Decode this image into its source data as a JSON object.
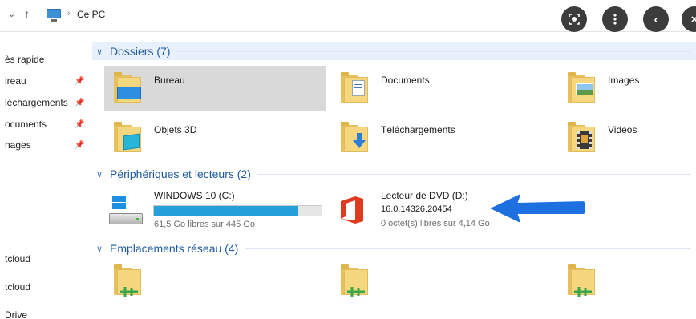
{
  "address": {
    "location": "Ce PC",
    "separator": "›"
  },
  "top_buttons": [
    "lens-icon",
    "more-icon",
    "back-icon",
    "close-icon"
  ],
  "sidebar": {
    "items": [
      {
        "label": "ès rapide",
        "pinned": false
      },
      {
        "label": "ireau",
        "pinned": true
      },
      {
        "label": "léchargements",
        "pinned": true
      },
      {
        "label": "ocuments",
        "pinned": true
      },
      {
        "label": "nages",
        "pinned": true
      },
      {
        "label": "tcloud",
        "pinned": false
      },
      {
        "label": "tcloud",
        "pinned": false
      },
      {
        "label": "Drive",
        "pinned": false
      }
    ]
  },
  "groups": {
    "folders": {
      "title": "Dossiers (7)",
      "items": [
        {
          "label": "Bureau",
          "icon": "desktop-folder-icon"
        },
        {
          "label": "Documents",
          "icon": "documents-folder-icon"
        },
        {
          "label": "Images",
          "icon": "pictures-folder-icon"
        },
        {
          "label": "Objets 3D",
          "icon": "3d-objects-folder-icon"
        },
        {
          "label": "Téléchargements",
          "icon": "downloads-folder-icon"
        },
        {
          "label": "Vidéos",
          "icon": "videos-folder-icon"
        }
      ]
    },
    "devices": {
      "title": "Périphériques et lecteurs (2)",
      "drive_c": {
        "name": "WINDOWS 10 (C:)",
        "space": "61,5 Go libres sur 445 Go",
        "used_fraction": 0.862
      },
      "drive_d": {
        "name": "Lecteur de DVD (D:)",
        "version": "16.0.14326.20454",
        "space": "0 octet(s) libres sur 4,14 Go"
      }
    },
    "network": {
      "title": "Emplacements réseau (4)"
    }
  },
  "colors": {
    "accent": "#26a0da",
    "group_title": "#1e5aa0",
    "selected_tile": "#d9d9d9",
    "folder": "#f5d77f",
    "office_red": "#e03a1e",
    "arrow_blue": "#1e6fe0"
  }
}
